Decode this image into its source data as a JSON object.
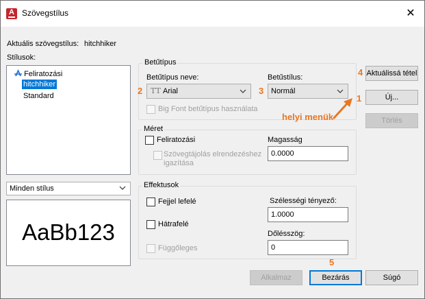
{
  "window": {
    "title": "Szövegstílus",
    "close_glyph": "✕",
    "app_icon_letter": "A"
  },
  "current_style": {
    "label": "Aktuális szövegstílus:",
    "value": "hitchhiker"
  },
  "styles": {
    "label": "Stílusok:",
    "items": [
      {
        "label": "Feliratozási",
        "annotative_icon": "annotative-icon"
      },
      {
        "label": "hitchhiker",
        "selected": true
      },
      {
        "label": "Standard"
      }
    ],
    "filter": {
      "value": "Minden stílus"
    }
  },
  "preview": {
    "text": "AaBb123"
  },
  "font": {
    "group_title": "Betűtípus",
    "name_label": "Betűtípus neve:",
    "name_value": "Arial",
    "name_icon": "truetype-font-icon",
    "style_label": "Betűstílus:",
    "style_value": "Normál",
    "bigfont_label": "Big Font betűtípus használata"
  },
  "size": {
    "group_title": "Méret",
    "annotative_label": "Feliratozási",
    "match_orientation_label_1": "Szövegtájolás elrendezéshez",
    "match_orientation_label_2": "igazítása",
    "height_label": "Magasság",
    "height_value": "0.0000"
  },
  "effects": {
    "group_title": "Effektusok",
    "upside_down_label": "Fejjel lefelé",
    "backwards_label": "Hátrafelé",
    "vertical_label": "Függőleges",
    "width_factor_label": "Szélességi tényező:",
    "width_factor_value": "1.0000",
    "oblique_label": "Dőlésszög:",
    "oblique_value": "0"
  },
  "buttons": {
    "set_current": "Aktuálissá tétel",
    "new": "Új...",
    "delete": "Törlés",
    "apply": "Alkalmaz",
    "close": "Bezárás",
    "help": "Súgó"
  },
  "callouts": {
    "n1": "1",
    "n2": "2",
    "n3": "3",
    "n4": "4",
    "n5": "5",
    "shortcut_menus": "helyi menük",
    "color": "#e87722"
  },
  "colors": {
    "selection": "#0078d7",
    "app_icon": "#c4262e"
  }
}
